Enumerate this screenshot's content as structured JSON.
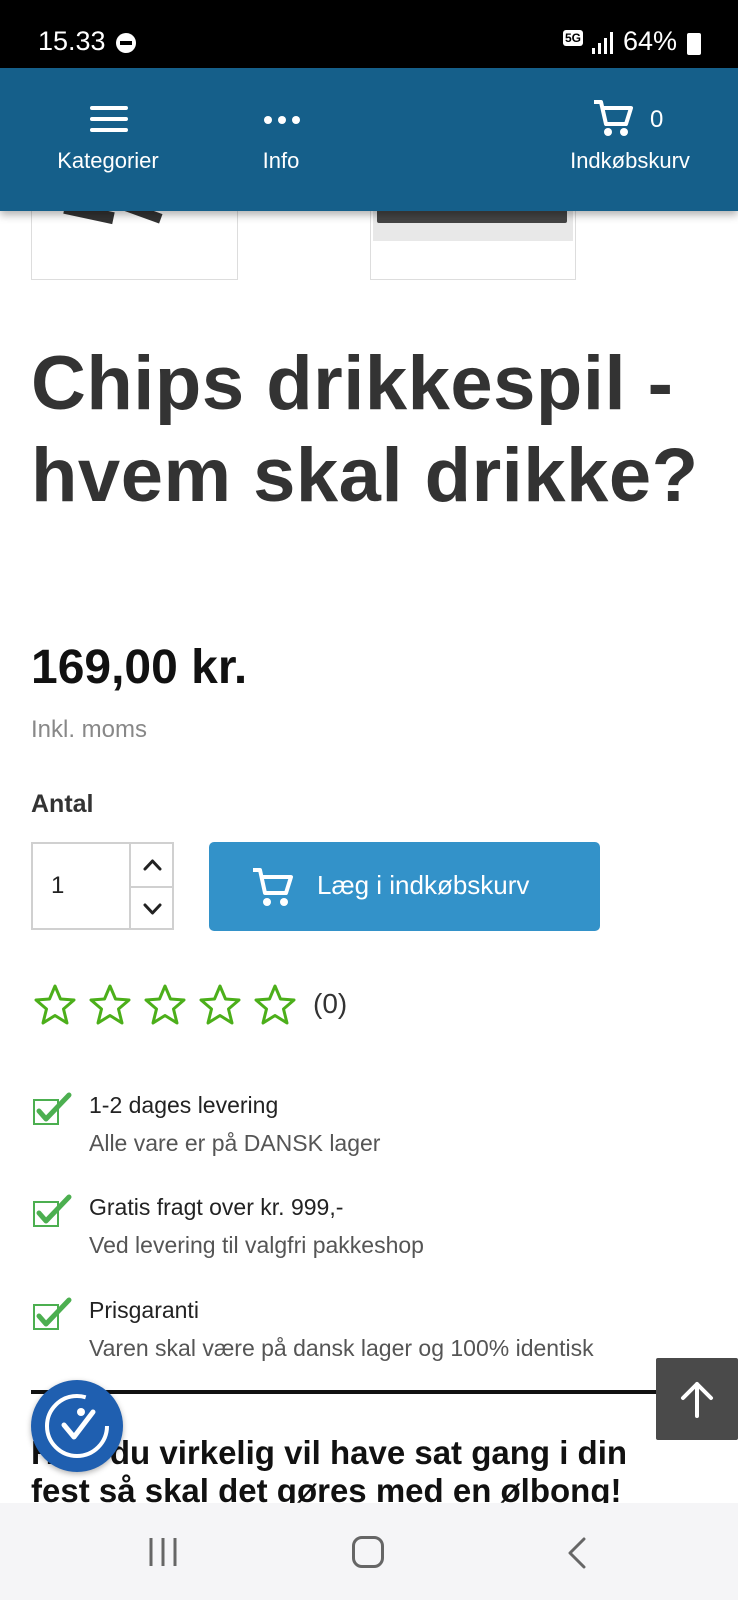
{
  "status_bar": {
    "time": "15.33",
    "network": "5G",
    "battery": "64%"
  },
  "nav": {
    "categories_label": "Kategorier",
    "info_label": "Info",
    "cart_label": "Indkøbskurv",
    "cart_count": "0"
  },
  "product": {
    "title": "Chips drikkespil - hvem skal drikke?",
    "price": "169,00 kr.",
    "vat_note": "Inkl. moms",
    "quantity_label": "Antal",
    "quantity_value": "1",
    "add_to_cart_label": "Læg i indkøbskurv",
    "rating_count": "(0)",
    "rating_stars": 0,
    "rating_max": 5
  },
  "features": [
    {
      "title": "1-2 dages levering",
      "subtitle": "Alle vare er på DANSK lager"
    },
    {
      "title": "Gratis fragt over kr. 999,-",
      "subtitle": "Ved levering til valgfri pakkeshop"
    },
    {
      "title": "Prisgaranti",
      "subtitle": "Varen skal være på dansk lager og 100% identisk"
    }
  ],
  "description": {
    "line1": "Hvis du virkelig vil have sat gang i din",
    "line2": "fest så skal det gøres med en ølbong!"
  },
  "colors": {
    "nav_bg": "#155f8a",
    "button_bg": "#3392c9",
    "star_green": "#4caf1a",
    "check_green": "#4caf50"
  },
  "icons": [
    "hamburger-icon",
    "more-icon",
    "cart-icon",
    "chevron-up-icon",
    "chevron-down-icon",
    "star-icon",
    "checkmark-icon",
    "arrow-up-icon",
    "accessibility-icon"
  ]
}
